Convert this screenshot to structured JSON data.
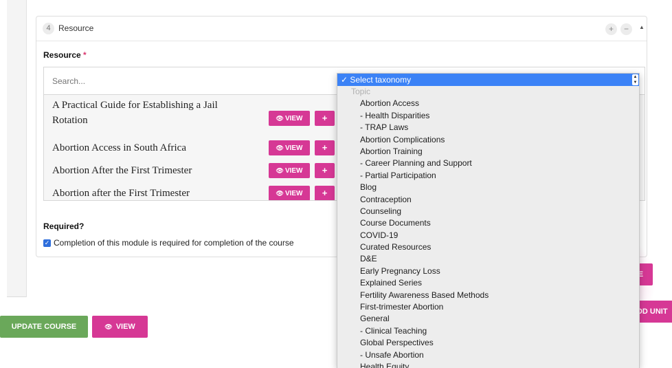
{
  "module": {
    "number": "4",
    "title": "Resource",
    "controls": {
      "add": "+",
      "remove": "−",
      "collapse": "▲"
    }
  },
  "resource_field": {
    "label": "Resource",
    "required_marker": "*",
    "search_placeholder": "Search..."
  },
  "results": [
    {
      "title_line1": "A Practical Guide for Establishing a Jail",
      "title_line2": "Rotation",
      "view_label": "VIEW",
      "add_label": "+"
    },
    {
      "title_line1": "Abortion Access in South Africa",
      "view_label": "VIEW",
      "add_label": "+"
    },
    {
      "title_line1": "Abortion After the First Trimester",
      "view_label": "VIEW",
      "add_label": "+"
    },
    {
      "title_line1": "Abortion after the First Trimester",
      "view_label": "VIEW",
      "add_label": "+"
    }
  ],
  "required_section": {
    "label": "Required?",
    "checkbox_label": "Completion of this module is required for completion of the course",
    "checked": true
  },
  "side_buttons": {
    "partial_label": "LE",
    "add_unit_label": "ADD UNIT"
  },
  "footer": {
    "update_label": "UPDATE COURSE",
    "view_label": "VIEW"
  },
  "taxonomy_dropdown": {
    "selected": "✓ Select taxonomy",
    "group_label": "Topic",
    "options": [
      "Abortion Access",
      "- Health Disparities",
      "- TRAP Laws",
      "Abortion Complications",
      "Abortion Training",
      "- Career Planning and Support",
      "- Partial Participation",
      "Blog",
      "Contraception",
      "Counseling",
      "Course Documents",
      "COVID-19",
      "Curated Resources",
      "D&E",
      "Early Pregnancy Loss",
      "Explained Series",
      "Fertility Awareness Based Methods",
      "First-trimester Abortion",
      "General",
      "- Clinical Teaching",
      "Global Perspectives",
      "- Unsafe Abortion",
      "Health Equity"
    ]
  },
  "colors": {
    "accent_pink": "#d63895",
    "update_green": "#6aa85a",
    "select_blue": "#3b82f6"
  }
}
